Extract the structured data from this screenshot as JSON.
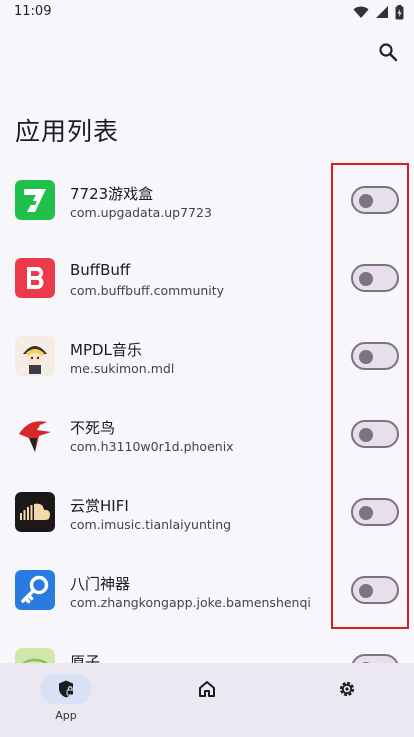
{
  "status_bar": {
    "time": "11:09"
  },
  "header": {
    "title": "应用列表"
  },
  "apps": [
    {
      "name": "7723游戏盒",
      "package": "com.upgadata.up7723",
      "icon": "7723-app-icon",
      "enabled": false
    },
    {
      "name": "BuffBuff",
      "package": "com.buffbuff.community",
      "icon": "buffbuff-app-icon",
      "enabled": false
    },
    {
      "name": "MPDL音乐",
      "package": "me.sukimon.mdl",
      "icon": "mpdl-app-icon",
      "enabled": false
    },
    {
      "name": "不死鸟",
      "package": "com.h3110w0r1d.phoenix",
      "icon": "phoenix-app-icon",
      "enabled": false
    },
    {
      "name": "云赏HIFI",
      "package": "com.imusic.tianlaiyunting",
      "icon": "soundcloud-app-icon",
      "enabled": false
    },
    {
      "name": "八门神器",
      "package": "com.zhangkongapp.joke.bamenshenqi",
      "icon": "key-app-icon",
      "enabled": false
    },
    {
      "name": "原子",
      "package": "",
      "icon": "yuanzi-app-icon",
      "enabled": false
    }
  ],
  "bottom_nav": {
    "items": [
      {
        "label": "App",
        "icon": "shield-lock-icon",
        "active": true
      },
      {
        "label": "",
        "icon": "home-icon",
        "active": false
      },
      {
        "label": "",
        "icon": "gear-icon",
        "active": false
      }
    ]
  },
  "colors": {
    "accent": "#d9e2f5",
    "highlight": "#d61f1f",
    "switch_off": "#79747e"
  }
}
